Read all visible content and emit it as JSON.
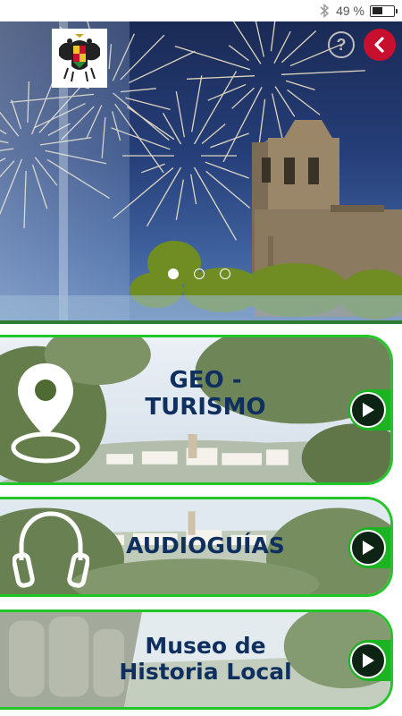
{
  "status_bar": {
    "battery_text": "49 %",
    "battery_level": 0.49,
    "icons": [
      "bluetooth-icon",
      "battery-icon"
    ]
  },
  "hero": {
    "slides_count": 3,
    "active_slide": 1,
    "buttons": {
      "help": "?",
      "back": "back-icon"
    },
    "colors": {
      "back_button": "#c8102e",
      "sky": "#263f7a"
    }
  },
  "cards": [
    {
      "title_line1": "GEO -",
      "title_line2": "TURISMO",
      "icon": "map-pin-icon"
    },
    {
      "title_line1": "AUDIOGUÍAS",
      "icon": "headphones-icon"
    },
    {
      "title_line1": "Museo de",
      "title_line2": "Historia Local",
      "icon": "play-icon"
    }
  ],
  "colors": {
    "accent_green": "#21c628",
    "title_navy": "#0f2f5f"
  }
}
